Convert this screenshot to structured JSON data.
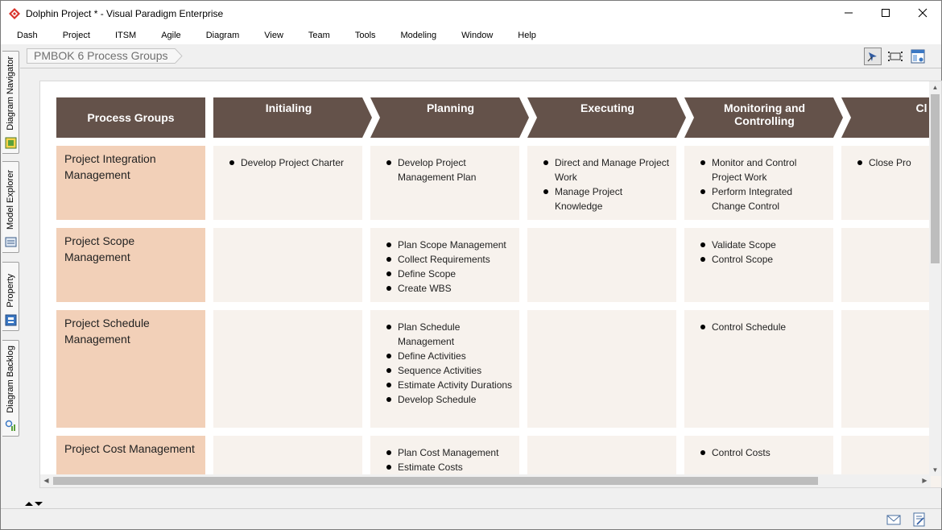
{
  "window": {
    "title": "Dolphin Project * - Visual Paradigm Enterprise",
    "controls": [
      "minimize",
      "maximize",
      "close"
    ]
  },
  "menu": [
    "Dash",
    "Project",
    "ITSM",
    "Agile",
    "Diagram",
    "View",
    "Team",
    "Tools",
    "Modeling",
    "Window",
    "Help"
  ],
  "dock_tabs": [
    "Diagram Navigator",
    "Model Explorer",
    "Property",
    "Diagram Backlog"
  ],
  "breadcrumb": "PMBOK 6 Process Groups",
  "toolbar_icons": [
    "pin-icon",
    "fit-to-window-icon",
    "layout-icon"
  ],
  "diagram": {
    "corner_header": "Process Groups",
    "columns": [
      {
        "label": "Initialing"
      },
      {
        "label": "Planning"
      },
      {
        "label": "Executing"
      },
      {
        "label": "Monitoring and Controlling"
      },
      {
        "label": "Cl"
      }
    ],
    "rows": [
      {
        "label": "Project Integration Management",
        "cells": [
          [
            "Develop Project Charter"
          ],
          [
            "Develop Project Management Plan"
          ],
          [
            "Direct and Manage Project Work",
            "Manage Project Knowledge"
          ],
          [
            "Monitor and Control Project Work",
            "Perform Integrated Change Control"
          ],
          [
            "Close Pro"
          ]
        ]
      },
      {
        "label": "Project Scope Management",
        "cells": [
          [],
          [
            "Plan Scope Management",
            "Collect Requirements",
            "Define Scope",
            "Create WBS"
          ],
          [],
          [
            "Validate Scope",
            "Control Scope"
          ],
          []
        ]
      },
      {
        "label": "Project Schedule Management",
        "cells": [
          [],
          [
            "Plan Schedule Management",
            "Define Activities",
            "Sequence Activities",
            "Estimate Activity Durations",
            "Develop Schedule"
          ],
          [],
          [
            "Control Schedule"
          ],
          []
        ]
      },
      {
        "label": "Project Cost Management",
        "cells": [
          [],
          [
            "Plan Cost Management",
            "Estimate Costs"
          ],
          [],
          [
            "Control Costs"
          ],
          []
        ]
      }
    ]
  },
  "colors": {
    "header_brown": "#64524a",
    "row_label_bg": "#f2d0b8",
    "cell_bg": "#f7f2ed",
    "app_icon_red": "#d9332b"
  },
  "status_icons": [
    "mail-icon",
    "edit-note-icon"
  ]
}
